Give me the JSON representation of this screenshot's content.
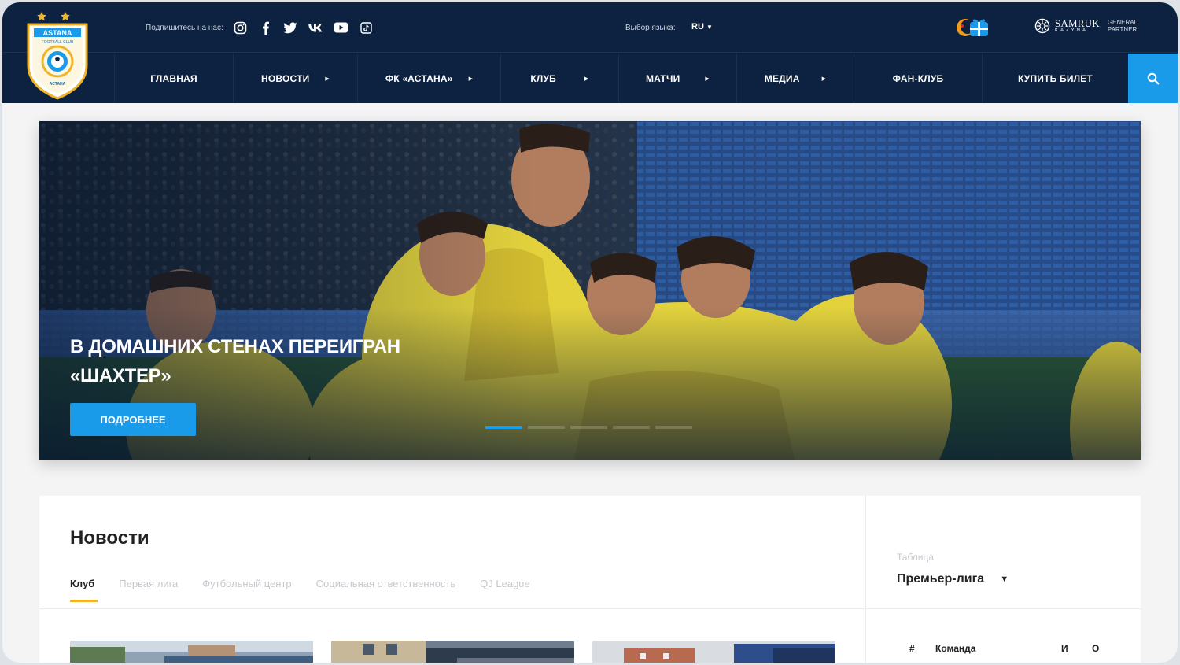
{
  "header": {
    "subscribe_label": "Подпишитесь на нас:",
    "socials": [
      "instagram-icon",
      "facebook-icon",
      "twitter-icon",
      "vk-icon",
      "youtube-icon",
      "tiktok-icon"
    ],
    "language_label": "Выбор языка:",
    "language_value": "RU",
    "partner": {
      "name": "SAMRUK",
      "sub": "KAZYNA",
      "tag_line1": "GENERAL",
      "tag_line2": "PARTNER"
    }
  },
  "logo": {
    "text_top": "ASTANA",
    "text_mid": "FOOTBALL CLUB",
    "text_bottom": "АСТАНА"
  },
  "nav": {
    "items": [
      {
        "label": "ГЛАВНАЯ",
        "has_arrow": false
      },
      {
        "label": "НОВОСТИ",
        "has_arrow": true
      },
      {
        "label": "ФК «АСТАНА»",
        "has_arrow": true
      },
      {
        "label": "КЛУБ",
        "has_arrow": true
      },
      {
        "label": "МАТЧИ",
        "has_arrow": true
      },
      {
        "label": "МЕДИА",
        "has_arrow": true
      },
      {
        "label": "ФАН-КЛУБ",
        "has_arrow": false
      },
      {
        "label": "КУПИТЬ БИЛЕТ",
        "has_arrow": false
      }
    ]
  },
  "hero": {
    "title_line1": "В ДОМАШНИХ СТЕНАХ ПЕРЕИГРАН",
    "title_line2": "«ШАХТЕР»",
    "button_label": "ПОДРОБНЕЕ",
    "slide_count": 5,
    "active_slide": 1
  },
  "news": {
    "heading": "Новости",
    "tabs": [
      "Клуб",
      "Первая лига",
      "Футбольный центр",
      "Социальная ответственность",
      "QJ League"
    ],
    "active_tab": 0
  },
  "standings": {
    "label": "Таблица",
    "league": "Премьер-лига",
    "columns": [
      "#",
      "Команда",
      "И",
      "О"
    ]
  },
  "colors": {
    "header_bg": "#0d2240",
    "accent_blue": "#1a9bea",
    "accent_gold": "#f0b428"
  }
}
